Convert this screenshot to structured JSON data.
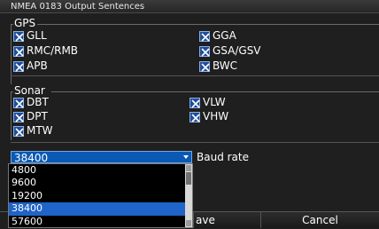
{
  "window": {
    "title": "NMEA 0183 Output Sentences"
  },
  "gps": {
    "title": "GPS",
    "items": [
      {
        "label": "GLL",
        "checked": true
      },
      {
        "label": "GGA",
        "checked": true
      },
      {
        "label": "RMC/RMB",
        "checked": true
      },
      {
        "label": "GSA/GSV",
        "checked": true
      },
      {
        "label": "APB",
        "checked": true
      },
      {
        "label": "BWC",
        "checked": true
      }
    ]
  },
  "sonar": {
    "title": "Sonar",
    "items": [
      {
        "label": "DBT",
        "checked": true
      },
      {
        "label": "VLW",
        "checked": true
      },
      {
        "label": "DPT",
        "checked": true
      },
      {
        "label": "VHW",
        "checked": true
      },
      {
        "label": "MTW",
        "checked": true
      }
    ]
  },
  "baud": {
    "selected": "38400",
    "label": "Baud rate",
    "options": [
      "4800",
      "9600",
      "19200",
      "38400",
      "57600"
    ]
  },
  "footer": {
    "save_label": "ave",
    "cancel_label": "Cancel"
  },
  "colors": {
    "accent": "#1f64c8",
    "background": "#1f1f1f"
  }
}
